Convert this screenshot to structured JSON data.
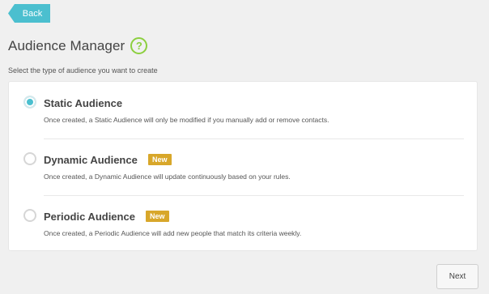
{
  "header": {
    "back_label": "Back",
    "title": "Audience Manager",
    "help_glyph": "?"
  },
  "subtitle": "Select the type of audience you want to create",
  "options": [
    {
      "name": "Static Audience",
      "badge": "",
      "description": "Once created, a Static Audience will only be modified if you manually add or remove contacts.",
      "selected": true
    },
    {
      "name": "Dynamic Audience",
      "badge": "New",
      "description": "Once created, a Dynamic Audience will update continuously based on your rules.",
      "selected": false
    },
    {
      "name": "Periodic Audience",
      "badge": "New",
      "description": "Once created, a Periodic Audience will add new people that match its criteria weekly.",
      "selected": false
    }
  ],
  "footer": {
    "next_label": "Next"
  },
  "colors": {
    "accent": "#4bbfcf",
    "help": "#8ccf3f",
    "badge": "#d8a72a"
  }
}
